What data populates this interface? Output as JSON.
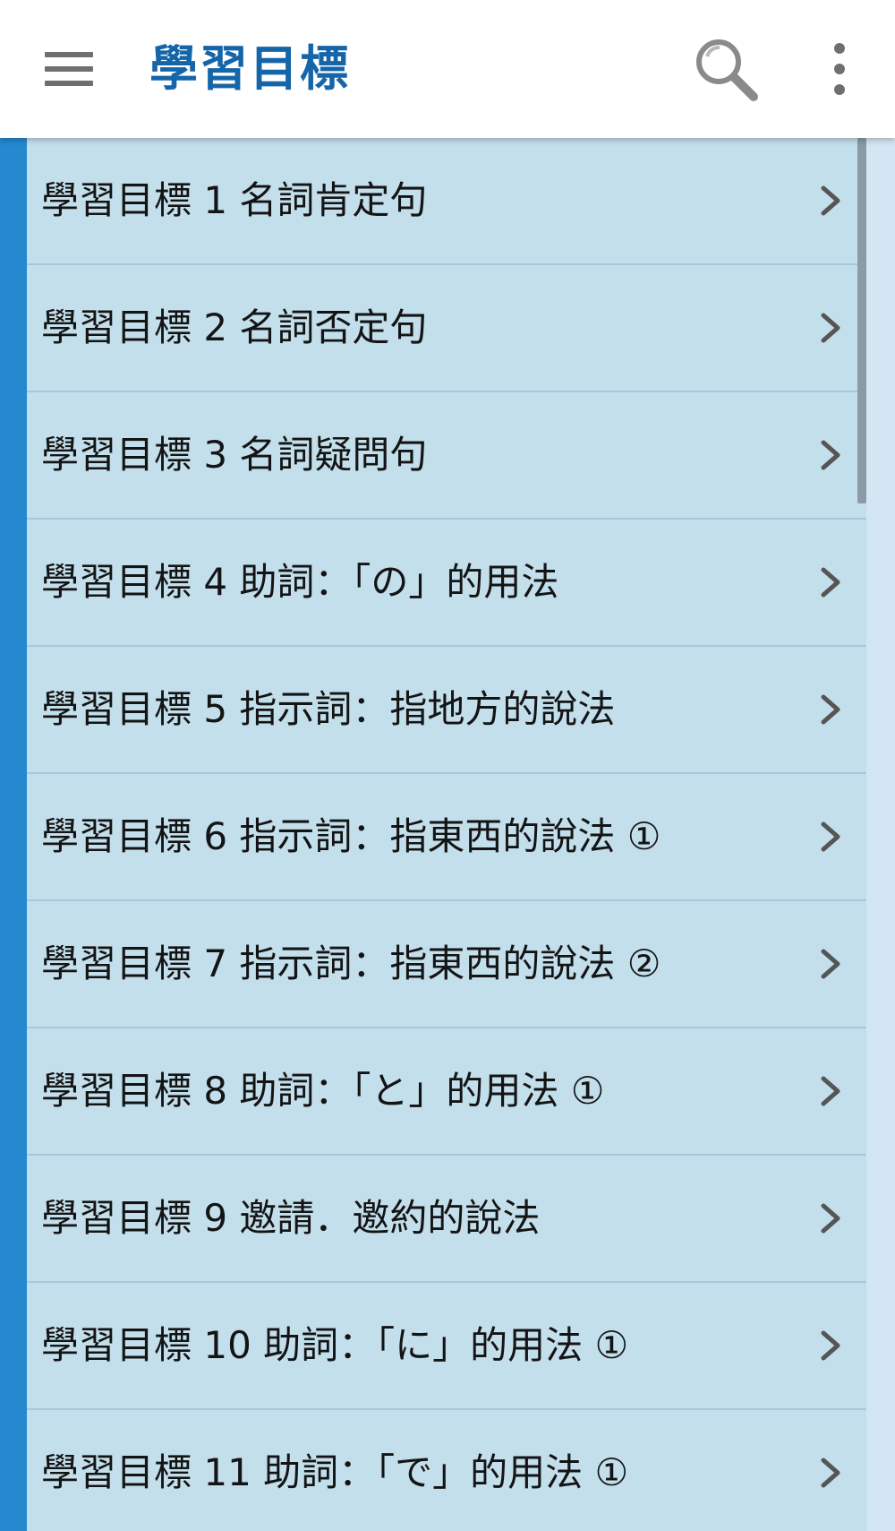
{
  "toolbar": {
    "title": "學習目標",
    "menu_icon": "hamburger-menu-icon",
    "search_icon": "search-icon",
    "more_icon": "more-vertical-icon",
    "title_color": "#1565a9"
  },
  "colors": {
    "accent": "#2489cf",
    "list_background": "#c3dfec",
    "text": "#141414"
  },
  "list": {
    "items": [
      {
        "label": "學習目標 1 名詞肯定句"
      },
      {
        "label": "學習目標 2 名詞否定句"
      },
      {
        "label": "學習目標 3 名詞疑問句"
      },
      {
        "label": "學習目標 4 助詞：「の」的用法"
      },
      {
        "label": "學習目標 5 指示詞：指地方的說法"
      },
      {
        "label": "學習目標 6 指示詞：指東西的說法 ①"
      },
      {
        "label": "學習目標 7 指示詞：指東西的說法 ②"
      },
      {
        "label": "學習目標 8 助詞：「と」的用法 ①"
      },
      {
        "label": "學習目標 9 邀請．邀約的說法"
      },
      {
        "label": "學習目標 10 助詞：「に」的用法 ①"
      },
      {
        "label": "學習目標 11 助詞：「で」的用法 ①"
      }
    ]
  }
}
